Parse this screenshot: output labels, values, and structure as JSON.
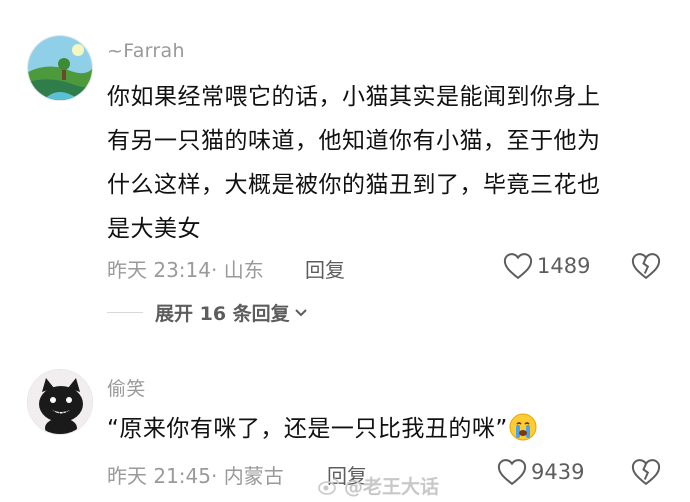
{
  "comments": [
    {
      "username": "~Farrah",
      "lines": [
        "你如果经常喂它的话，小猫其实是能闻到你身上",
        "有另一只猫的味道，他知道你有小猫，至于他为",
        "什么这样，大概是被你的猫丑到了，毕竟三花也",
        "是大美女"
      ],
      "meta": "昨天 23:14· 山东",
      "reply_label": "回复",
      "likes": "1489",
      "avatar_icon": "landscape-avatar"
    },
    {
      "username": "偷笑",
      "text": "“原来你有咪了，还是一只比我丑的咪”",
      "emoji_icon": "crying-face-emoji",
      "meta": "昨天 21:45· 内蒙古",
      "reply_label": "回复",
      "likes": "9439",
      "avatar_icon": "black-cat-avatar"
    }
  ],
  "expand_replies": "展开 16 条回复",
  "watermark": "@老王大话",
  "colors": {
    "meta": "#9a9a9a",
    "text": "#111111",
    "action": "#5d5d5d"
  }
}
